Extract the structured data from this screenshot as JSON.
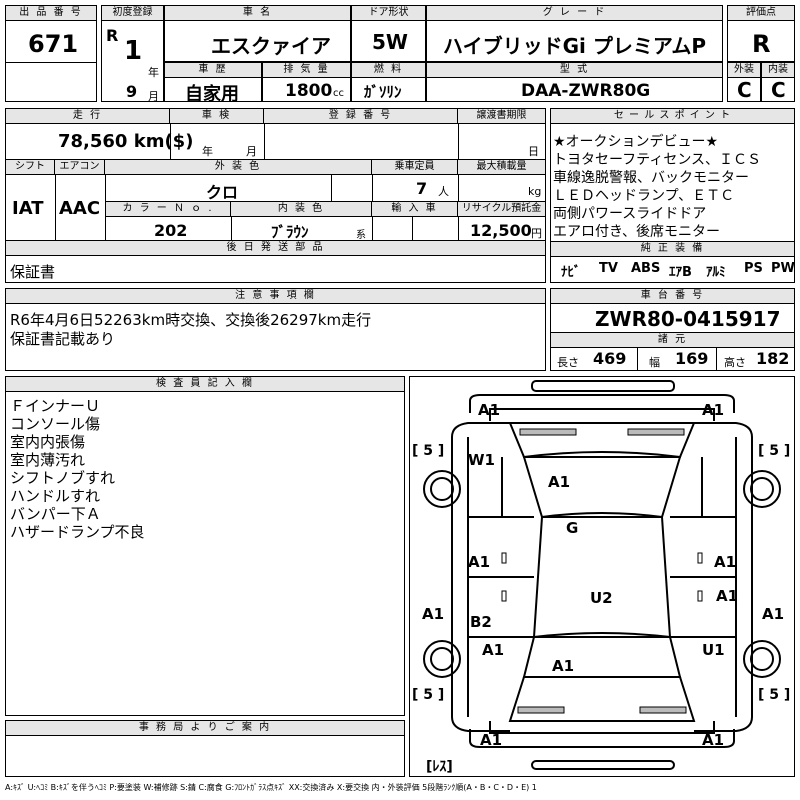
{
  "headers": {
    "lot_no": "出 品 番 号",
    "first_reg": "初度登録",
    "car_name": "車 名",
    "door": "ドア形状",
    "grade": "グ レ ー ド",
    "score": "評価点",
    "history": "車 歴",
    "displacement": "排 気 量",
    "fuel": "燃 料",
    "model_code": "型 式",
    "exterior": "外装",
    "interior": "内装",
    "mileage": "走 行",
    "inspection": "車 検",
    "reg_no": "登 録 番 号",
    "transfer": "譲渡書期限",
    "sales_points": "セ ー ル ス ポ イ ン ト",
    "shift": "シフト",
    "aircon": "エアコン",
    "color": "外 装 色",
    "capacity": "乗車定員",
    "max_load": "最大積載量",
    "color_no": "カ ラ ー Ｎ ｏ .",
    "int_color": "内 装 色",
    "import": "輸 入 車",
    "recycle": "リサイクル預託金",
    "later_parts": "後 日 発 送 部 品",
    "std_equipment": "純 正 装 備",
    "notes": "注 意 事 項 欄",
    "chassis_no": "車 台 番 号",
    "specs": "諸 元",
    "inspector": "検 査 員 記 入 欄",
    "office": "事 務 局 よ り ご 案 内"
  },
  "vehicle": {
    "lot_no": "671",
    "era": "R",
    "year": "1",
    "year_unit": "年",
    "month": "9",
    "month_unit": "月",
    "car_name": "エスクァイア",
    "door": "5W",
    "grade": "ハイブリッドGi プレミアムP",
    "score": "R",
    "history": "自家用",
    "displacement": "1800",
    "displacement_unit": "cc",
    "fuel": "ｶﾞｿﾘﾝ",
    "model_code": "DAA-ZWR80G",
    "exterior_grade": "C",
    "interior_grade": "C",
    "mileage": "78,560 km($)",
    "insp_year_unit": "年",
    "insp_month_unit": "月",
    "transfer_unit": "日",
    "shift": "IAT",
    "aircon": "AAC",
    "color": "クロ",
    "capacity": "7",
    "capacity_unit": "人",
    "load_unit": "kg",
    "color_no": "202",
    "int_color": "ﾌﾞﾗｳﾝ",
    "int_color_unit": "系",
    "recycle": "12,500",
    "recycle_unit": "円",
    "later_parts": "保証書",
    "chassis_no": "ZWR80-0415917",
    "length_label": "長さ",
    "length": "469",
    "width_label": "幅",
    "width": "169",
    "height_label": "高さ",
    "height": "182"
  },
  "sales_points": [
    "★オークションデビュー★",
    "トヨタセーフティセンス、ＩＣＳ",
    "車線逸脱警報、バックモニター",
    "ＬＥＤヘッドランプ、ＥＴＣ",
    "両側パワースライドドア",
    "エアロ付き、後席モニター"
  ],
  "equipment": [
    "ﾅﾋﾞ",
    "TV",
    "ABS",
    "ｴｱB",
    "ｱﾙﾐ",
    "PS",
    "PW"
  ],
  "notes": [
    "R6年4月6日52263km時交換、交換後26297km走行",
    "保証書記載あり"
  ],
  "inspector_notes": [
    "ＦインナーＵ",
    "コンソール傷",
    "室内内張傷",
    "室内薄汚れ",
    "シフトノブすれ",
    "ハンドルすれ",
    "バンパー下Ａ",
    "ハザードランプ不良"
  ],
  "diagram": {
    "tire_depth": [
      "[ 5 ]",
      "[ 5 ]",
      "[ 5 ]",
      "[ 5 ]"
    ],
    "spare": "[ﾚｽ]",
    "marks": [
      "A1",
      "A1",
      "W1",
      "A1",
      "G",
      "A1",
      "A1",
      "A1",
      "B2",
      "U2",
      "A1",
      "A1",
      "A1",
      "A1",
      "U1",
      "A1",
      "A1",
      "A1"
    ]
  },
  "legend": "A:ｷｽﾞ U:ﾍｺﾐ B:ｷｽﾞを伴うﾍｺﾐ P:要塗装 W:補修跡 S:錆 C:腐食 G:ﾌﾛﾝﾄｶﾞﾗｽ点ｷｽﾞ XX:交換済み X:要交換 内・外装評価 5段階ﾗﾝｸ順(A・B・C・D・E) 1"
}
